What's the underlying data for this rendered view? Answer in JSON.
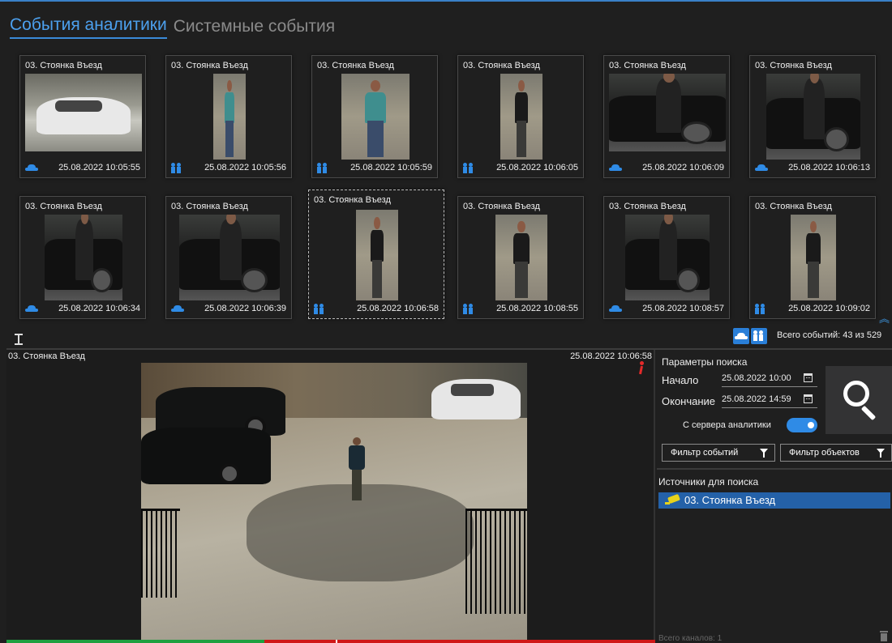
{
  "tabs": {
    "analytics": "События аналитики",
    "system": "Системные события"
  },
  "events": [
    {
      "camera": "03. Стоянка Въезд",
      "type": "car-icon",
      "time": "25.08.2022 10:05:55"
    },
    {
      "camera": "03. Стоянка Въезд",
      "type": "people-icon",
      "time": "25.08.2022 10:05:56"
    },
    {
      "camera": "03. Стоянка Въезд",
      "type": "people-icon",
      "time": "25.08.2022 10:05:59"
    },
    {
      "camera": "03. Стоянка Въезд",
      "type": "people-icon",
      "time": "25.08.2022 10:06:05"
    },
    {
      "camera": "03. Стоянка Въезд",
      "type": "car-icon",
      "time": "25.08.2022 10:06:09"
    },
    {
      "camera": "03. Стоянка Въезд",
      "type": "car-icon",
      "time": "25.08.2022 10:06:13"
    },
    {
      "camera": "03. Стоянка Въезд",
      "type": "car-icon",
      "time": "25.08.2022 10:06:34"
    },
    {
      "camera": "03. Стоянка Въезд",
      "type": "car-icon",
      "time": "25.08.2022 10:06:39"
    },
    {
      "camera": "03. Стоянка Въезд",
      "type": "people-icon",
      "time": "25.08.2022 10:06:58"
    },
    {
      "camera": "03. Стоянка Въезд",
      "type": "people-icon",
      "time": "25.08.2022 10:08:55"
    },
    {
      "camera": "03. Стоянка Въезд",
      "type": "car-icon",
      "time": "25.08.2022 10:08:57"
    },
    {
      "camera": "03. Стоянка Въезд",
      "type": "people-icon",
      "time": "25.08.2022 10:09:02"
    }
  ],
  "event_summary": {
    "total": "Всего событий: 43 из 529"
  },
  "player": {
    "camera": "03. Стоянка Въезд",
    "timestamp": "25.08.2022 10:06:58",
    "motion_icon": "walking-person-icon",
    "motion_icon_color": "#e42a2a"
  },
  "search": {
    "title": "Параметры поиска",
    "start_label": "Начало",
    "start_value": "25.08.2022 10:00",
    "end_label": "Окончание",
    "end_value": "25.08.2022 14:59",
    "server_label": "С сервера аналитики",
    "server_enabled": true,
    "event_filter": "Фильтр событий",
    "object_filter": "Фильтр объектов"
  },
  "sources": {
    "title": "Источники для поиска",
    "items": [
      "03. Стоянка Въезд"
    ],
    "channels": "Всего каналов: 1"
  },
  "colors": {
    "accent": "#2f8be6",
    "tab_active": "#4ca0ee",
    "selection": "#2461a8",
    "timeline_ok": "#1ea040",
    "timeline_alarm": "#d01818"
  }
}
